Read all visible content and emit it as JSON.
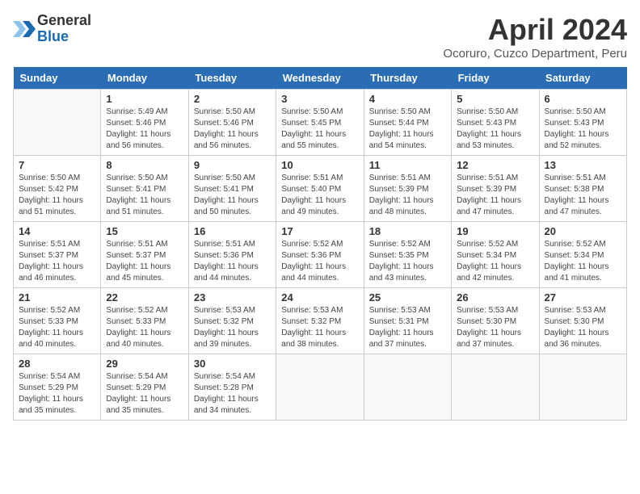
{
  "header": {
    "logo_general": "General",
    "logo_blue": "Blue",
    "title": "April 2024",
    "location": "Ocoruro, Cuzco Department, Peru"
  },
  "calendar": {
    "weekdays": [
      "Sunday",
      "Monday",
      "Tuesday",
      "Wednesday",
      "Thursday",
      "Friday",
      "Saturday"
    ],
    "weeks": [
      [
        {
          "day": "",
          "sunrise": "",
          "sunset": "",
          "daylight": ""
        },
        {
          "day": "1",
          "sunrise": "Sunrise: 5:49 AM",
          "sunset": "Sunset: 5:46 PM",
          "daylight": "Daylight: 11 hours and 56 minutes."
        },
        {
          "day": "2",
          "sunrise": "Sunrise: 5:50 AM",
          "sunset": "Sunset: 5:46 PM",
          "daylight": "Daylight: 11 hours and 56 minutes."
        },
        {
          "day": "3",
          "sunrise": "Sunrise: 5:50 AM",
          "sunset": "Sunset: 5:45 PM",
          "daylight": "Daylight: 11 hours and 55 minutes."
        },
        {
          "day": "4",
          "sunrise": "Sunrise: 5:50 AM",
          "sunset": "Sunset: 5:44 PM",
          "daylight": "Daylight: 11 hours and 54 minutes."
        },
        {
          "day": "5",
          "sunrise": "Sunrise: 5:50 AM",
          "sunset": "Sunset: 5:43 PM",
          "daylight": "Daylight: 11 hours and 53 minutes."
        },
        {
          "day": "6",
          "sunrise": "Sunrise: 5:50 AM",
          "sunset": "Sunset: 5:43 PM",
          "daylight": "Daylight: 11 hours and 52 minutes."
        }
      ],
      [
        {
          "day": "7",
          "sunrise": "Sunrise: 5:50 AM",
          "sunset": "Sunset: 5:42 PM",
          "daylight": "Daylight: 11 hours and 51 minutes."
        },
        {
          "day": "8",
          "sunrise": "Sunrise: 5:50 AM",
          "sunset": "Sunset: 5:41 PM",
          "daylight": "Daylight: 11 hours and 51 minutes."
        },
        {
          "day": "9",
          "sunrise": "Sunrise: 5:50 AM",
          "sunset": "Sunset: 5:41 PM",
          "daylight": "Daylight: 11 hours and 50 minutes."
        },
        {
          "day": "10",
          "sunrise": "Sunrise: 5:51 AM",
          "sunset": "Sunset: 5:40 PM",
          "daylight": "Daylight: 11 hours and 49 minutes."
        },
        {
          "day": "11",
          "sunrise": "Sunrise: 5:51 AM",
          "sunset": "Sunset: 5:39 PM",
          "daylight": "Daylight: 11 hours and 48 minutes."
        },
        {
          "day": "12",
          "sunrise": "Sunrise: 5:51 AM",
          "sunset": "Sunset: 5:39 PM",
          "daylight": "Daylight: 11 hours and 47 minutes."
        },
        {
          "day": "13",
          "sunrise": "Sunrise: 5:51 AM",
          "sunset": "Sunset: 5:38 PM",
          "daylight": "Daylight: 11 hours and 47 minutes."
        }
      ],
      [
        {
          "day": "14",
          "sunrise": "Sunrise: 5:51 AM",
          "sunset": "Sunset: 5:37 PM",
          "daylight": "Daylight: 11 hours and 46 minutes."
        },
        {
          "day": "15",
          "sunrise": "Sunrise: 5:51 AM",
          "sunset": "Sunset: 5:37 PM",
          "daylight": "Daylight: 11 hours and 45 minutes."
        },
        {
          "day": "16",
          "sunrise": "Sunrise: 5:51 AM",
          "sunset": "Sunset: 5:36 PM",
          "daylight": "Daylight: 11 hours and 44 minutes."
        },
        {
          "day": "17",
          "sunrise": "Sunrise: 5:52 AM",
          "sunset": "Sunset: 5:36 PM",
          "daylight": "Daylight: 11 hours and 44 minutes."
        },
        {
          "day": "18",
          "sunrise": "Sunrise: 5:52 AM",
          "sunset": "Sunset: 5:35 PM",
          "daylight": "Daylight: 11 hours and 43 minutes."
        },
        {
          "day": "19",
          "sunrise": "Sunrise: 5:52 AM",
          "sunset": "Sunset: 5:34 PM",
          "daylight": "Daylight: 11 hours and 42 minutes."
        },
        {
          "day": "20",
          "sunrise": "Sunrise: 5:52 AM",
          "sunset": "Sunset: 5:34 PM",
          "daylight": "Daylight: 11 hours and 41 minutes."
        }
      ],
      [
        {
          "day": "21",
          "sunrise": "Sunrise: 5:52 AM",
          "sunset": "Sunset: 5:33 PM",
          "daylight": "Daylight: 11 hours and 40 minutes."
        },
        {
          "day": "22",
          "sunrise": "Sunrise: 5:52 AM",
          "sunset": "Sunset: 5:33 PM",
          "daylight": "Daylight: 11 hours and 40 minutes."
        },
        {
          "day": "23",
          "sunrise": "Sunrise: 5:53 AM",
          "sunset": "Sunset: 5:32 PM",
          "daylight": "Daylight: 11 hours and 39 minutes."
        },
        {
          "day": "24",
          "sunrise": "Sunrise: 5:53 AM",
          "sunset": "Sunset: 5:32 PM",
          "daylight": "Daylight: 11 hours and 38 minutes."
        },
        {
          "day": "25",
          "sunrise": "Sunrise: 5:53 AM",
          "sunset": "Sunset: 5:31 PM",
          "daylight": "Daylight: 11 hours and 37 minutes."
        },
        {
          "day": "26",
          "sunrise": "Sunrise: 5:53 AM",
          "sunset": "Sunset: 5:30 PM",
          "daylight": "Daylight: 11 hours and 37 minutes."
        },
        {
          "day": "27",
          "sunrise": "Sunrise: 5:53 AM",
          "sunset": "Sunset: 5:30 PM",
          "daylight": "Daylight: 11 hours and 36 minutes."
        }
      ],
      [
        {
          "day": "28",
          "sunrise": "Sunrise: 5:54 AM",
          "sunset": "Sunset: 5:29 PM",
          "daylight": "Daylight: 11 hours and 35 minutes."
        },
        {
          "day": "29",
          "sunrise": "Sunrise: 5:54 AM",
          "sunset": "Sunset: 5:29 PM",
          "daylight": "Daylight: 11 hours and 35 minutes."
        },
        {
          "day": "30",
          "sunrise": "Sunrise: 5:54 AM",
          "sunset": "Sunset: 5:28 PM",
          "daylight": "Daylight: 11 hours and 34 minutes."
        },
        {
          "day": "",
          "sunrise": "",
          "sunset": "",
          "daylight": ""
        },
        {
          "day": "",
          "sunrise": "",
          "sunset": "",
          "daylight": ""
        },
        {
          "day": "",
          "sunrise": "",
          "sunset": "",
          "daylight": ""
        },
        {
          "day": "",
          "sunrise": "",
          "sunset": "",
          "daylight": ""
        }
      ]
    ]
  }
}
